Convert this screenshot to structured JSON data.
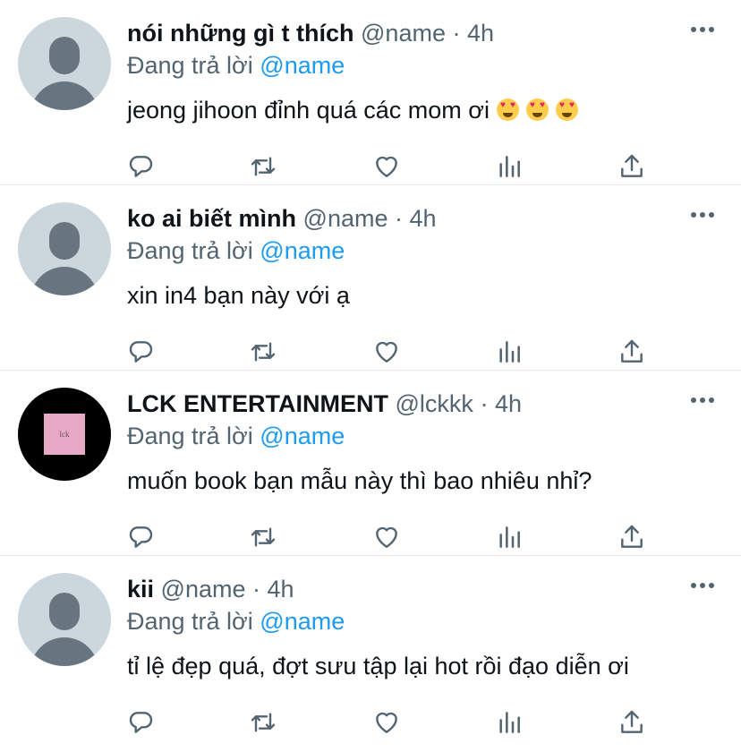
{
  "tweets": [
    {
      "display_name": "nói những gì t thích",
      "handle": "@name",
      "separator": "·",
      "time": "4h",
      "reply_prefix": "Đang trả lời",
      "reply_to": "@name",
      "text": "jeong jihoon đỉnh quá các mom ơi",
      "emoji": [
        "smiling-face-with-heart-eyes",
        "smiling-face-with-heart-eyes",
        "smiling-face-with-heart-eyes"
      ],
      "avatar": "default-avatar"
    },
    {
      "display_name": "ko ai biết mình",
      "handle": "@name",
      "separator": "·",
      "time": "4h",
      "reply_prefix": "Đang trả lời",
      "reply_to": "@name",
      "text": "xin in4 bạn này với ạ",
      "avatar": "default-avatar"
    },
    {
      "display_name": "LCK ENTERTAINMENT",
      "handle": "@lckkk",
      "separator": "·",
      "time": "4h",
      "reply_prefix": "Đang trả lời",
      "reply_to": "@name",
      "text": "muốn book bạn mẫu này thì bao nhiêu nhỉ?",
      "avatar": "lck-logo-avatar",
      "avatar_text": "lck"
    },
    {
      "display_name": "kii",
      "handle": "@name",
      "separator": "·",
      "time": "4h",
      "reply_prefix": "Đang trả lời",
      "reply_to": "@name",
      "text": "tỉ lệ đẹp quá, đợt sưu tập lại hot rồi đạo diễn ơi",
      "avatar": "default-avatar"
    }
  ],
  "actions": [
    "reply-icon",
    "retweet-icon",
    "like-icon",
    "analytics-icon",
    "share-icon",
    "more-icon"
  ],
  "colors": {
    "text": "#0f1419",
    "secondary": "#536471",
    "link": "#1d9bf0",
    "divider": "#e6ecf0",
    "avatar_bg": "#ccd6dd",
    "avatar_fg": "#66757f",
    "lck_square": "#e7a9c5"
  }
}
